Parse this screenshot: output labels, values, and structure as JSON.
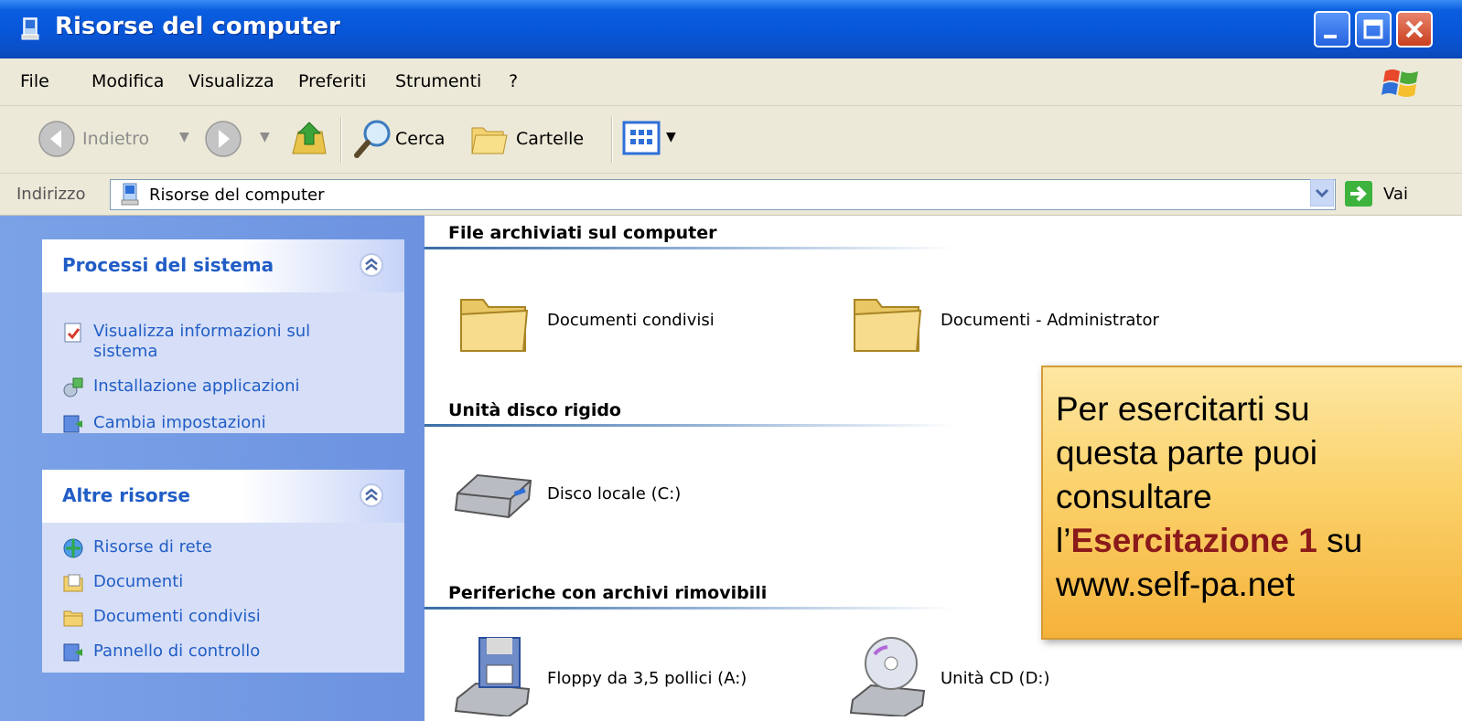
{
  "window": {
    "title": "Risorse del computer"
  },
  "menu": {
    "items": [
      "File",
      "Modifica",
      "Visualizza",
      "Preferiti",
      "Strumenti",
      "?"
    ]
  },
  "toolbar": {
    "back_label": "Indietro",
    "search_label": "Cerca",
    "folders_label": "Cartelle"
  },
  "address": {
    "label": "Indirizzo",
    "value": "Risorse del computer",
    "go_label": "Vai"
  },
  "taskpane": {
    "system_tasks": {
      "title": "Processi del sistema",
      "items": [
        "Visualizza informazioni sul sistema",
        "Installazione applicazioni",
        "Cambia impostazioni"
      ]
    },
    "other_places": {
      "title": "Altre risorse",
      "items": [
        "Risorse di rete",
        "Documenti",
        "Documenti condivisi",
        "Pannello di controllo"
      ]
    }
  },
  "groups": [
    {
      "title": "File archiviati sul computer",
      "items": [
        "Documenti condivisi",
        "Documenti - Administrator"
      ]
    },
    {
      "title": "Unità disco rigido",
      "items": [
        "Disco locale (C:)"
      ]
    },
    {
      "title": "Periferiche con archivi rimovibili",
      "items": [
        "Floppy da 3,5 pollici (A:)",
        "Unità CD (D:)"
      ]
    }
  ],
  "note": {
    "line1": "Per esercitarti su",
    "line2": "questa parte puoi",
    "line3": "consultare",
    "line4_prefix": "l’",
    "line4_highlight": "Esercitazione 1",
    "line4_suffix": " su",
    "line5": "www.self-pa.net"
  },
  "colors": {
    "titlebar": "#0756d8",
    "taskpane": "#6c92e0",
    "link": "#215dc6",
    "note": "#fbd26b"
  }
}
